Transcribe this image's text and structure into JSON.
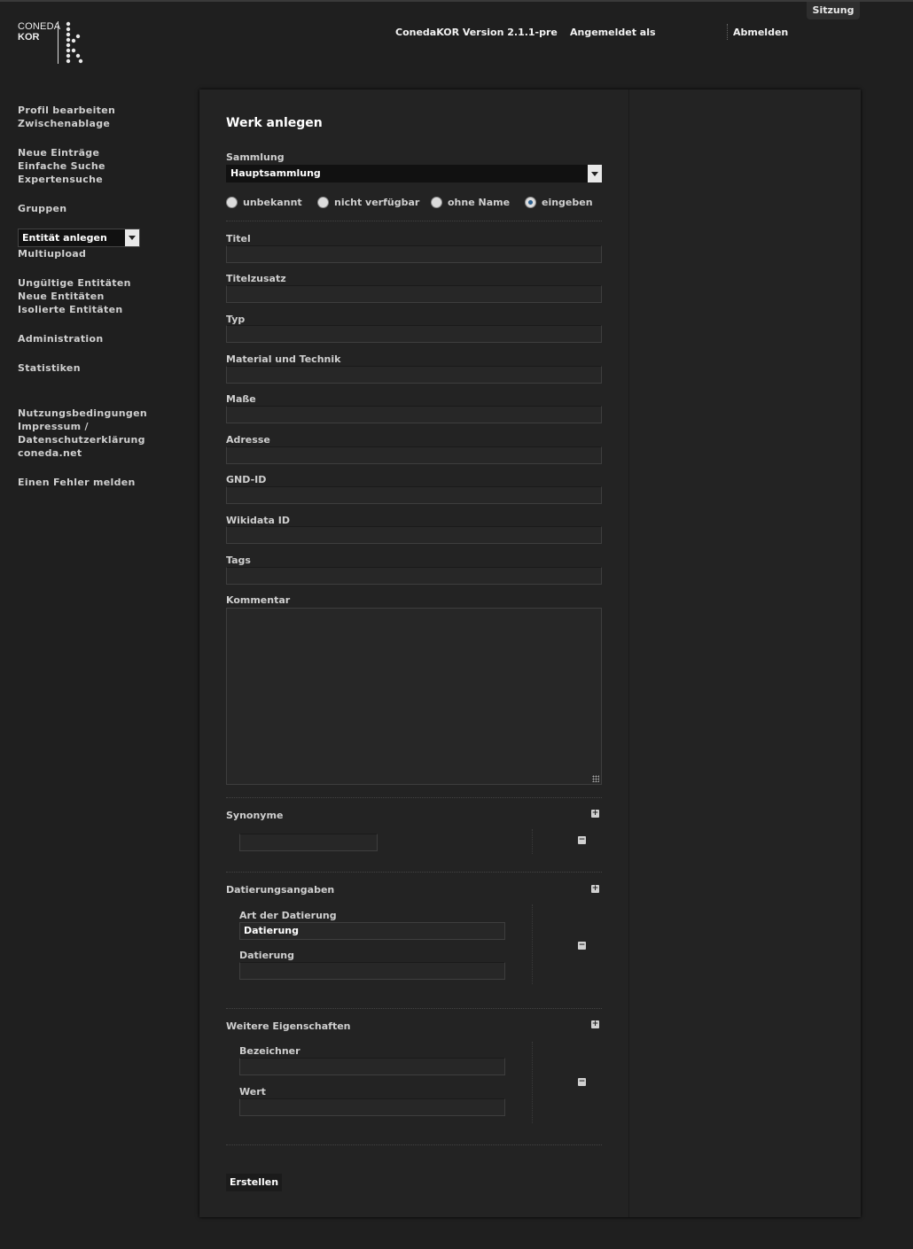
{
  "header": {
    "logo_line1": "CONEDA",
    "logo_line2": "KOR",
    "version": "ConedaKOR Version 2.1.1-pre",
    "logged_in_as": "Angemeldet als",
    "logout": "Abmelden",
    "session_tab": "Sitzung"
  },
  "sidebar": {
    "profile": "Profil bearbeiten",
    "clipboard": "Zwischenablage",
    "new_entries": "Neue Einträge",
    "simple_search": "Einfache Suche",
    "expert_search": "Expertensuche",
    "groups": "Gruppen",
    "create_entity": "Entität anlegen",
    "multiupload": "Multiupload",
    "invalid_entities": "Ungültige Entitäten",
    "new_entities": "Neue Entitäten",
    "isolated_entities": "Isolierte Entitäten",
    "administration": "Administration",
    "statistics": "Statistiken",
    "terms": "Nutzungsbedingungen",
    "imprint": "Impressum /",
    "privacy": "Datenschutzerklärung",
    "coneda": "coneda.net",
    "report_bug": "Einen Fehler melden"
  },
  "form": {
    "title": "Werk anlegen",
    "collection_label": "Sammlung",
    "collection_value": "Hauptsammlung",
    "name_options": [
      "unbekannt",
      "nicht verfügbar",
      "ohne Name",
      "eingeben"
    ],
    "name_selected": "eingeben",
    "fields": {
      "titel": "Titel",
      "titelzusatz": "Titelzusatz",
      "typ": "Typ",
      "material": "Material und Technik",
      "masse": "Maße",
      "adresse": "Adresse",
      "gnd": "GND-ID",
      "wikidata": "Wikidata ID",
      "tags": "Tags",
      "kommentar": "Kommentar"
    },
    "synonyms_label": "Synonyme",
    "dating_label": "Datierungsangaben",
    "dating_kind_label": "Art der Datierung",
    "dating_kind_value": "Datierung",
    "dating_value_label": "Datierung",
    "properties_label": "Weitere Eigenschaften",
    "property_key_label": "Bezeichner",
    "property_value_label": "Wert",
    "submit": "Erstellen"
  },
  "icons": {
    "add": "plus-icon",
    "remove": "minus-icon"
  }
}
